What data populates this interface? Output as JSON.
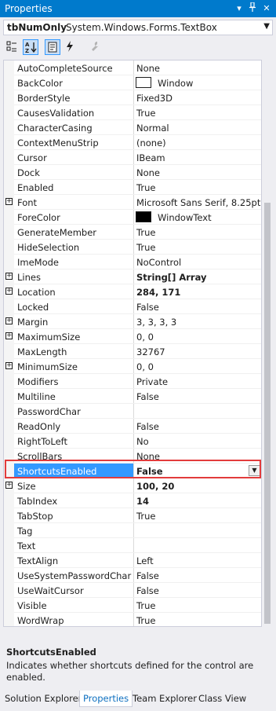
{
  "window": {
    "title": "Properties"
  },
  "object_selector": {
    "name": "tbNumOnly",
    "type": "System.Windows.Forms.TextBox"
  },
  "toolbar": {
    "buttons": [
      {
        "icon": "categorized-icon",
        "selected": false
      },
      {
        "icon": "alphabetical-icon",
        "selected": true
      },
      {
        "icon": "properties-icon",
        "selected": true
      },
      {
        "icon": "events-lightning-icon",
        "selected": false
      },
      {
        "icon": "property-pages-wrench-icon",
        "selected": false
      }
    ]
  },
  "properties": [
    {
      "name": "AutoCompleteSource",
      "value": "None"
    },
    {
      "name": "BackColor",
      "value": "Window",
      "swatch": "#ffffff"
    },
    {
      "name": "BorderStyle",
      "value": "Fixed3D"
    },
    {
      "name": "CausesValidation",
      "value": "True"
    },
    {
      "name": "CharacterCasing",
      "value": "Normal"
    },
    {
      "name": "ContextMenuStrip",
      "value": "(none)"
    },
    {
      "name": "Cursor",
      "value": "IBeam"
    },
    {
      "name": "Dock",
      "value": "None"
    },
    {
      "name": "Enabled",
      "value": "True"
    },
    {
      "name": "Font",
      "value": "Microsoft Sans Serif, 8.25pt",
      "expandable": true
    },
    {
      "name": "ForeColor",
      "value": "WindowText",
      "swatch": "#000000"
    },
    {
      "name": "GenerateMember",
      "value": "True"
    },
    {
      "name": "HideSelection",
      "value": "True"
    },
    {
      "name": "ImeMode",
      "value": "NoControl"
    },
    {
      "name": "Lines",
      "value": "String[] Array",
      "expandable": true,
      "bold": true
    },
    {
      "name": "Location",
      "value": "284, 171",
      "expandable": true,
      "bold": true
    },
    {
      "name": "Locked",
      "value": "False"
    },
    {
      "name": "Margin",
      "value": "3, 3, 3, 3",
      "expandable": true
    },
    {
      "name": "MaximumSize",
      "value": "0, 0",
      "expandable": true
    },
    {
      "name": "MaxLength",
      "value": "32767"
    },
    {
      "name": "MinimumSize",
      "value": "0, 0",
      "expandable": true
    },
    {
      "name": "Modifiers",
      "value": "Private"
    },
    {
      "name": "Multiline",
      "value": "False"
    },
    {
      "name": "PasswordChar",
      "value": ""
    },
    {
      "name": "ReadOnly",
      "value": "False"
    },
    {
      "name": "RightToLeft",
      "value": "No"
    },
    {
      "name": "ScrollBars",
      "value": "None"
    },
    {
      "name": "ShortcutsEnabled",
      "value": "False",
      "selected": true
    },
    {
      "name": "Size",
      "value": "100, 20",
      "expandable": true,
      "bold": true
    },
    {
      "name": "TabIndex",
      "value": "14",
      "bold": true
    },
    {
      "name": "TabStop",
      "value": "True"
    },
    {
      "name": "Tag",
      "value": ""
    },
    {
      "name": "Text",
      "value": ""
    },
    {
      "name": "TextAlign",
      "value": "Left"
    },
    {
      "name": "UseSystemPasswordChar",
      "value": "False"
    },
    {
      "name": "UseWaitCursor",
      "value": "False"
    },
    {
      "name": "Visible",
      "value": "True"
    },
    {
      "name": "WordWrap",
      "value": "True"
    }
  ],
  "description": {
    "title": "ShortcutsEnabled",
    "text": "Indicates whether shortcuts defined for the control are enabled."
  },
  "tabs": [
    {
      "label": "Solution Explorer",
      "active": false
    },
    {
      "label": "Properties",
      "active": true
    },
    {
      "label": "Team Explorer",
      "active": false
    },
    {
      "label": "Class View",
      "active": false
    }
  ],
  "colors": {
    "accent": "#007acc",
    "selection": "#3399ff",
    "highlight_border": "#e23c3c"
  }
}
